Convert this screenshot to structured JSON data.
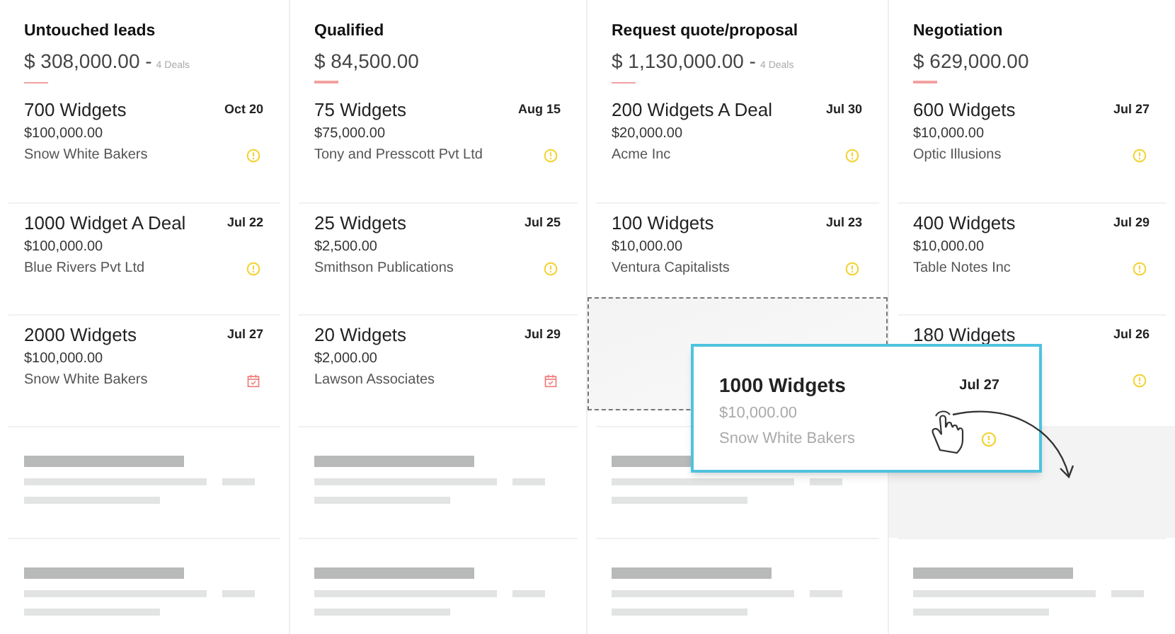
{
  "columns": [
    {
      "title": "Untouched leads",
      "amount": "$ 308,000.00 -",
      "deals": "4 Deals",
      "cards": [
        {
          "kind": "warning_deal",
          "title": "700 Widgets",
          "date": "Oct 20",
          "amount": "$100,000.00",
          "company": "Snow White Bakers"
        },
        {
          "kind": "warning_deal",
          "title": "1000 Widget A Deal",
          "date": "Jul 22",
          "amount": "$100,000.00",
          "company": "Blue Rivers Pvt Ltd"
        },
        {
          "kind": "task_deal",
          "title": "2000 Widgets",
          "date": "Jul 27",
          "amount": "$100,000.00",
          "company": "Snow White Bakers"
        },
        {
          "kind": "placeholder"
        },
        {
          "kind": "placeholder"
        }
      ]
    },
    {
      "title": "Qualified",
      "amount": "$ 84,500.00",
      "cards": [
        {
          "kind": "warning_deal",
          "title": "75 Widgets",
          "date": "Aug 15",
          "amount": "$75,000.00",
          "company": "Tony and Presscott Pvt Ltd"
        },
        {
          "kind": "warning_deal",
          "title": "25 Widgets",
          "date": "Jul 25",
          "amount": "$2,500.00",
          "company": "Smithson Publications"
        },
        {
          "kind": "task_deal",
          "title": "20 Widgets",
          "date": "Jul 29",
          "amount": "$2,000.00",
          "company": "Lawson Associates"
        },
        {
          "kind": "placeholder"
        },
        {
          "kind": "placeholder"
        }
      ]
    },
    {
      "title": "Request quote/proposal",
      "amount": "$ 1,130,000.00 -",
      "deals": "4 Deals",
      "cards": [
        {
          "kind": "warning_deal",
          "title": "200 Widgets A Deal",
          "date": "Jul 30",
          "amount": "$20,000.00",
          "company": "Acme Inc"
        },
        {
          "kind": "warning_deal",
          "title": "100 Widgets",
          "date": "Jul 23",
          "amount": "$10,000.00",
          "company": "Ventura Capitalists"
        },
        {
          "kind": "vacated"
        },
        {
          "kind": "placeholder"
        },
        {
          "kind": "placeholder"
        }
      ]
    },
    {
      "title": "Negotiation",
      "amount": "$ 629,000.00",
      "cards": [
        {
          "kind": "warning_deal",
          "title": "600 Widgets",
          "date": "Jul 27",
          "amount": "$10,000.00",
          "company": "Optic Illusions"
        },
        {
          "kind": "warning_deal",
          "title": "400 Widgets",
          "date": "Jul 29",
          "amount": "$10,000.00",
          "company": "Table Notes Inc"
        },
        {
          "kind": "warning_deal",
          "title": "180 Widgets",
          "date": "Jul 26"
        },
        {
          "kind": "drop_target"
        },
        {
          "kind": "placeholder"
        }
      ]
    }
  ],
  "dragged_card": {
    "kind": "warning_deal",
    "title": "1000 Widgets",
    "date": "Jul 27",
    "amount": "$10,000.00",
    "company": "Snow White Bakers"
  }
}
